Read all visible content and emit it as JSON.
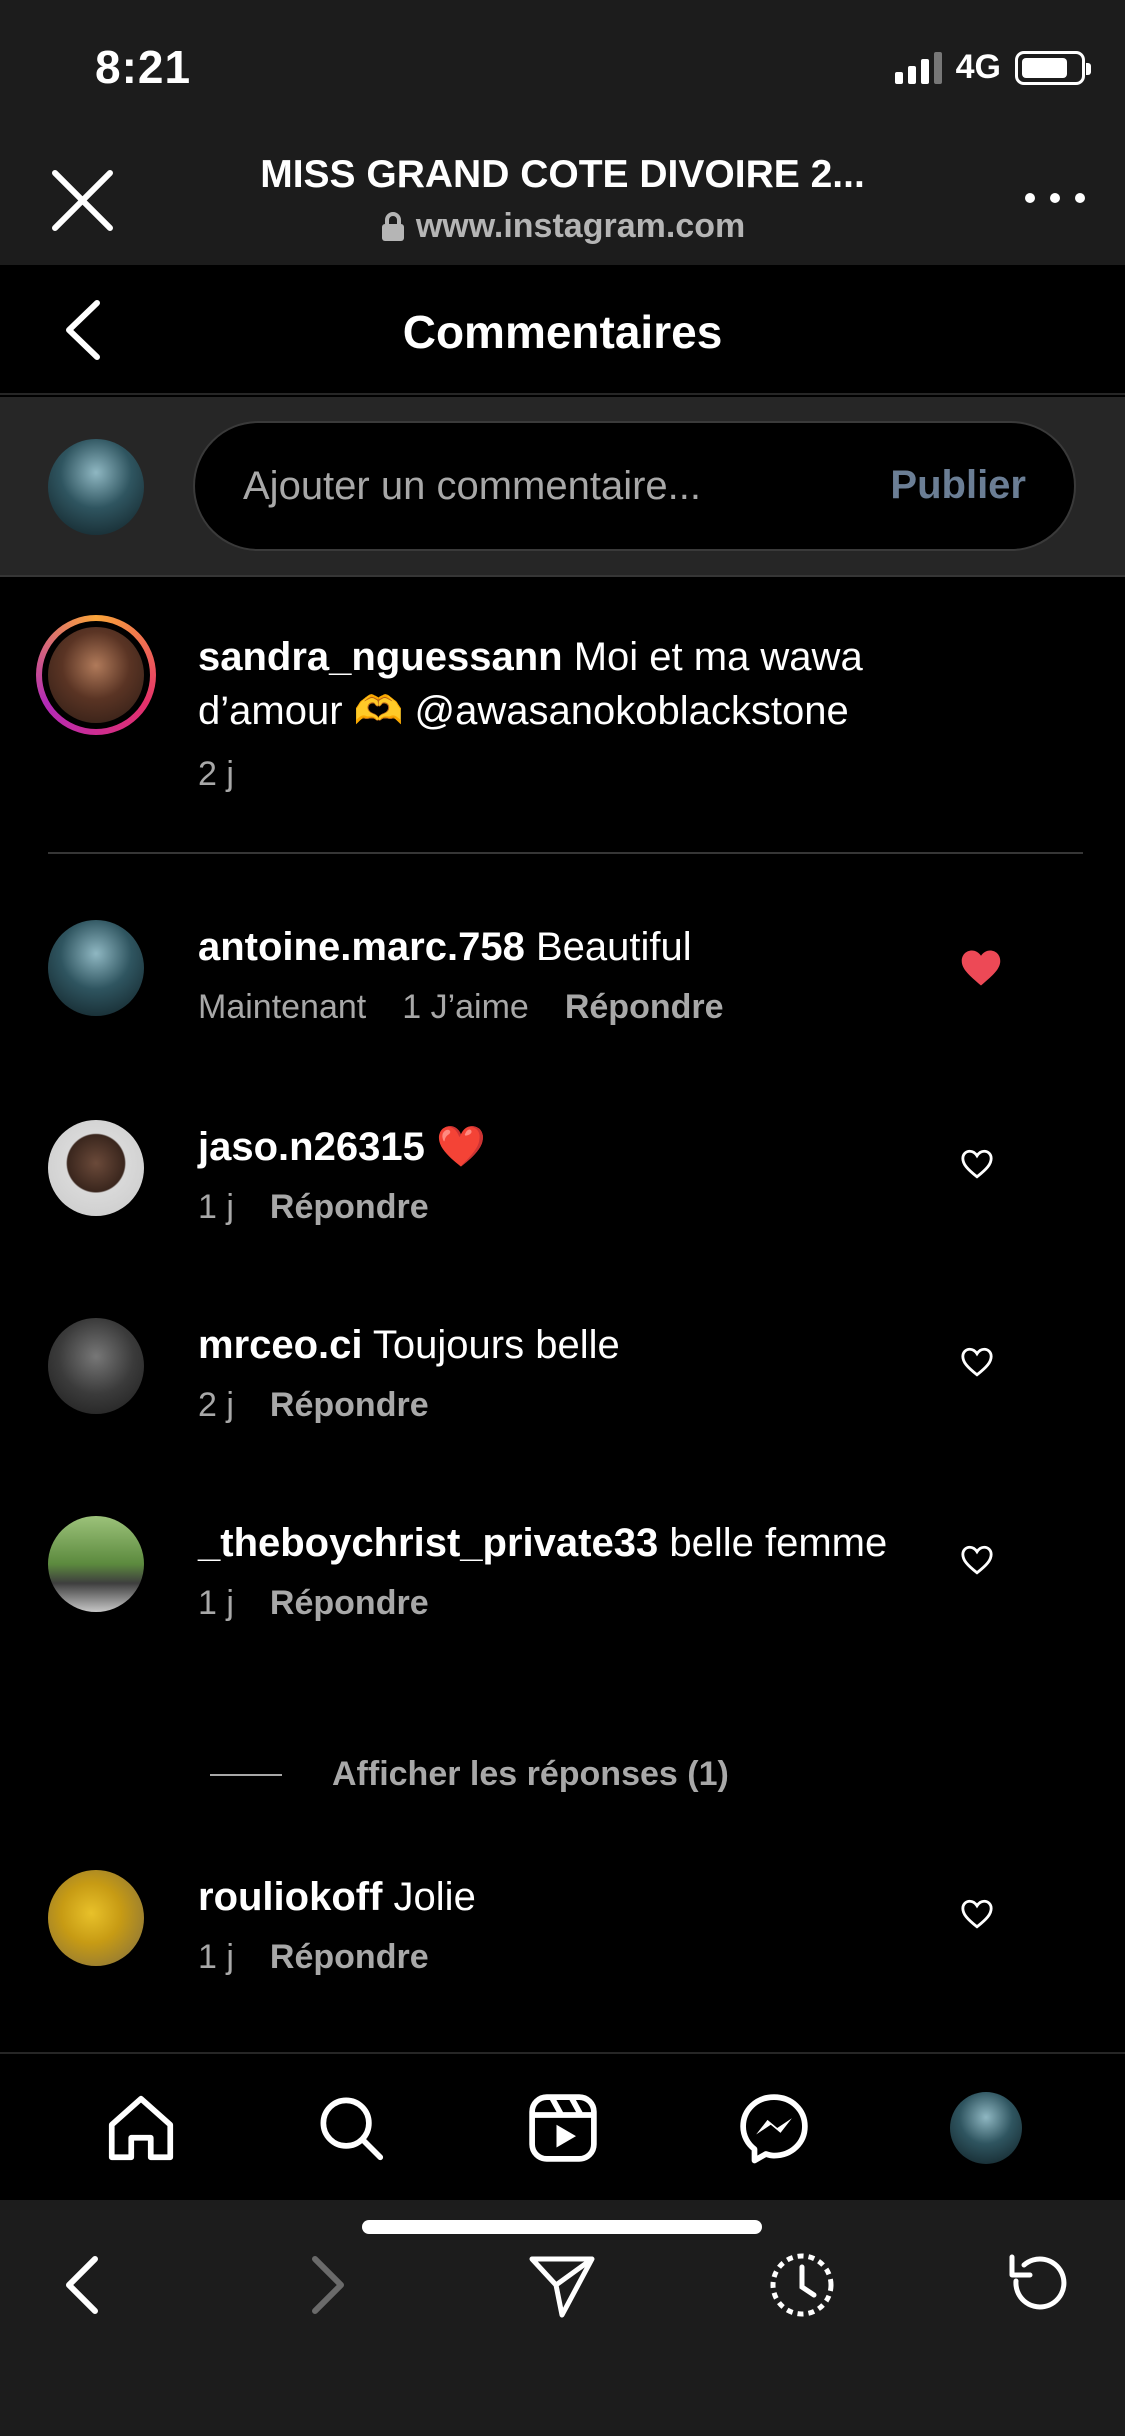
{
  "status": {
    "time": "8:21",
    "network": "4G"
  },
  "browser": {
    "title": "MISS GRAND COTE DIVOIRE 2...",
    "url": "www.instagram.com"
  },
  "header": {
    "title": "Commentaires"
  },
  "composer": {
    "placeholder": "Ajouter un commentaire...",
    "publish_label": "Publier"
  },
  "caption": {
    "username": "sandra_nguessann",
    "text": "Moi et ma wawa d’amour 🫶 @awasanokoblackstone",
    "time": "2 j"
  },
  "comments": [
    {
      "username": "antoine.marc.758",
      "text": "Beautiful",
      "time": "Maintenant",
      "likes": "1 J’aime",
      "reply": "Répondre",
      "liked": true
    },
    {
      "username": "jaso.n26315",
      "text": "❤️",
      "time": "1 j",
      "reply": "Répondre",
      "liked": false
    },
    {
      "username": "mrceo.ci",
      "text": "Toujours belle",
      "time": "2 j",
      "reply": "Répondre",
      "liked": false
    },
    {
      "username": "_theboychrist_private33",
      "text": "belle femme",
      "time": "1 j",
      "reply": "Répondre",
      "liked": false
    },
    {
      "username": "rouliokoff",
      "text": "Jolie",
      "time": "1 j",
      "reply": "Répondre",
      "liked": false
    }
  ],
  "view_replies": "Afficher les réponses (1)",
  "tabs": [
    "home-icon",
    "search-icon",
    "reels-icon",
    "messenger-icon",
    "profile-avatar"
  ],
  "safari_buttons": [
    "back-icon",
    "forward-icon",
    "share-icon",
    "history-icon",
    "reload-icon"
  ],
  "colors": {
    "like": "#ed4956",
    "publish": "#6b7e95",
    "muted": "#a8a8a8"
  }
}
